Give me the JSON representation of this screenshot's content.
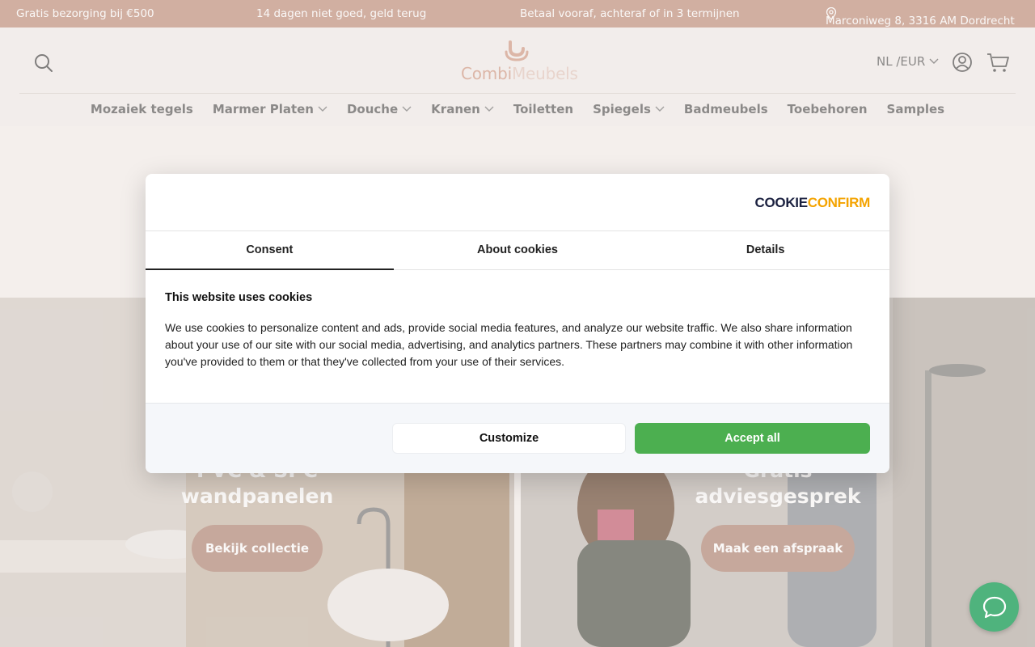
{
  "topbar": {
    "item1": "Gratis bezorging bij €500",
    "item2": "14 dagen niet goed, geld terug",
    "item3": "Betaal vooraf, achteraf of in 3 termijnen",
    "address": "Marconiweg 8, 3316 AM Dordrecht"
  },
  "header": {
    "logo_part1": "Combi",
    "logo_part2": "Meubels",
    "lang_currency": "NL /EUR"
  },
  "nav": {
    "items": [
      {
        "label": "Mozaiek tegels",
        "dropdown": false
      },
      {
        "label": "Marmer Platen",
        "dropdown": true
      },
      {
        "label": "Douche",
        "dropdown": true
      },
      {
        "label": "Kranen",
        "dropdown": true
      },
      {
        "label": "Toiletten",
        "dropdown": false
      },
      {
        "label": "Spiegels",
        "dropdown": true
      },
      {
        "label": "Badmeubels",
        "dropdown": false
      },
      {
        "label": "Toebehoren",
        "dropdown": false
      },
      {
        "label": "Samples",
        "dropdown": false
      }
    ]
  },
  "hero": {
    "left_title_line1": "PVC & SPC",
    "left_title_line2": "wandpanelen",
    "left_button": "Bekijk collectie",
    "right_title_line1": "Gratis",
    "right_title_line2": "adviesgesprek",
    "right_button": "Maak een afspraak"
  },
  "cookie_modal": {
    "brand_part1": "COOKIE",
    "brand_part2": "CONFIRM",
    "tabs": [
      "Consent",
      "About cookies",
      "Details"
    ],
    "active_tab": "Consent",
    "heading": "This website uses cookies",
    "body": "We use cookies to personalize content and ads, provide social media features, and analyze our website traffic. We also share information about your use of our site with our social media, advertising, and analytics partners. These partners may combine it with other information you've provided to them or that they've collected from your use of their services.",
    "customize_label": "Customize",
    "accept_label": "Accept all"
  },
  "colors": {
    "topbar": "#c08f7c",
    "accent_button": "#b08574",
    "accept_green": "#4caf50",
    "chat_green": "#4fb37d"
  }
}
